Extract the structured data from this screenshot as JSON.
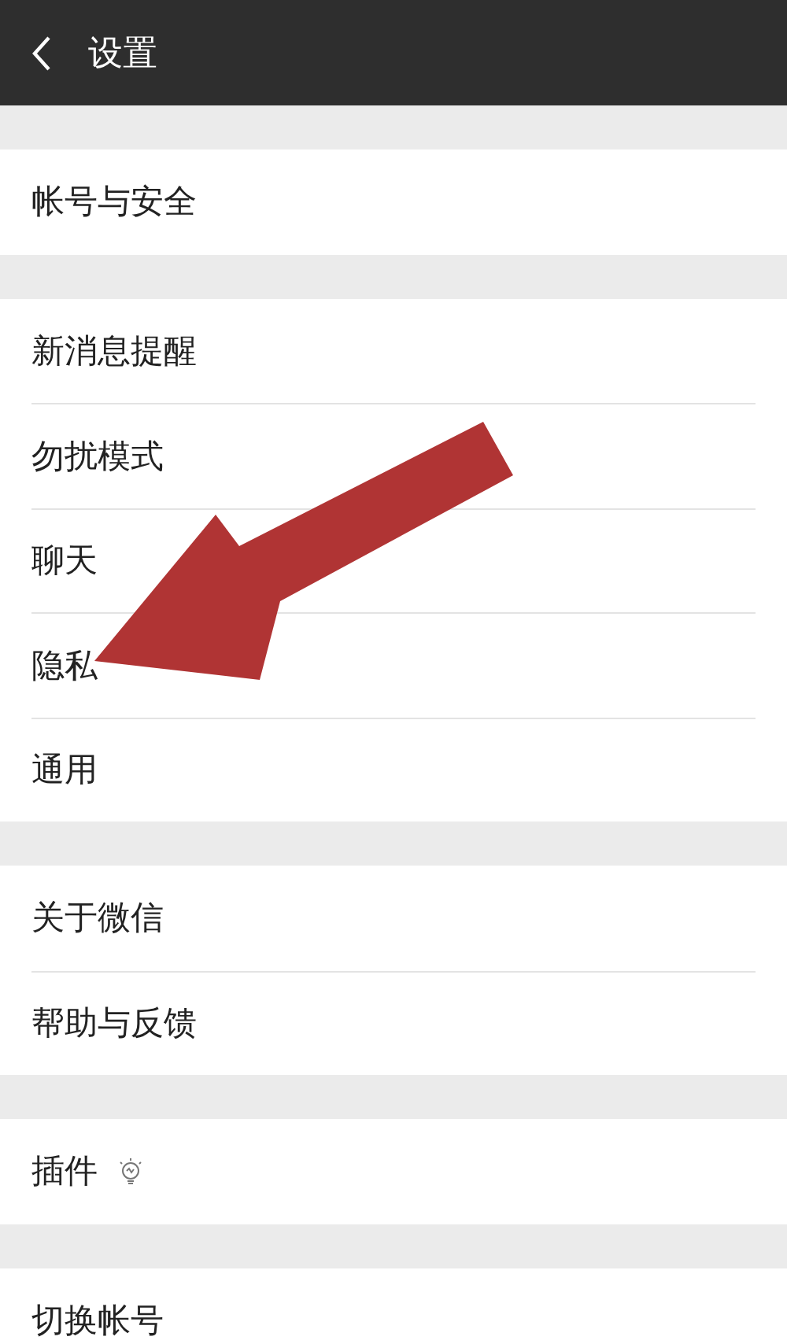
{
  "header": {
    "title": "设置"
  },
  "groups": [
    {
      "items": [
        {
          "label": "帐号与安全",
          "kind": "plain"
        }
      ]
    },
    {
      "items": [
        {
          "label": "新消息提醒",
          "kind": "plain"
        },
        {
          "label": "勿扰模式",
          "kind": "plain"
        },
        {
          "label": "聊天",
          "kind": "plain"
        },
        {
          "label": "隐私",
          "kind": "plain"
        },
        {
          "label": "通用",
          "kind": "plain"
        }
      ]
    },
    {
      "items": [
        {
          "label": "关于微信",
          "kind": "plain"
        },
        {
          "label": "帮助与反馈",
          "kind": "plain"
        }
      ]
    },
    {
      "items": [
        {
          "label": "插件",
          "kind": "with-icon"
        }
      ]
    },
    {
      "items": [
        {
          "label": "切换帐号",
          "kind": "plain"
        }
      ]
    }
  ]
}
